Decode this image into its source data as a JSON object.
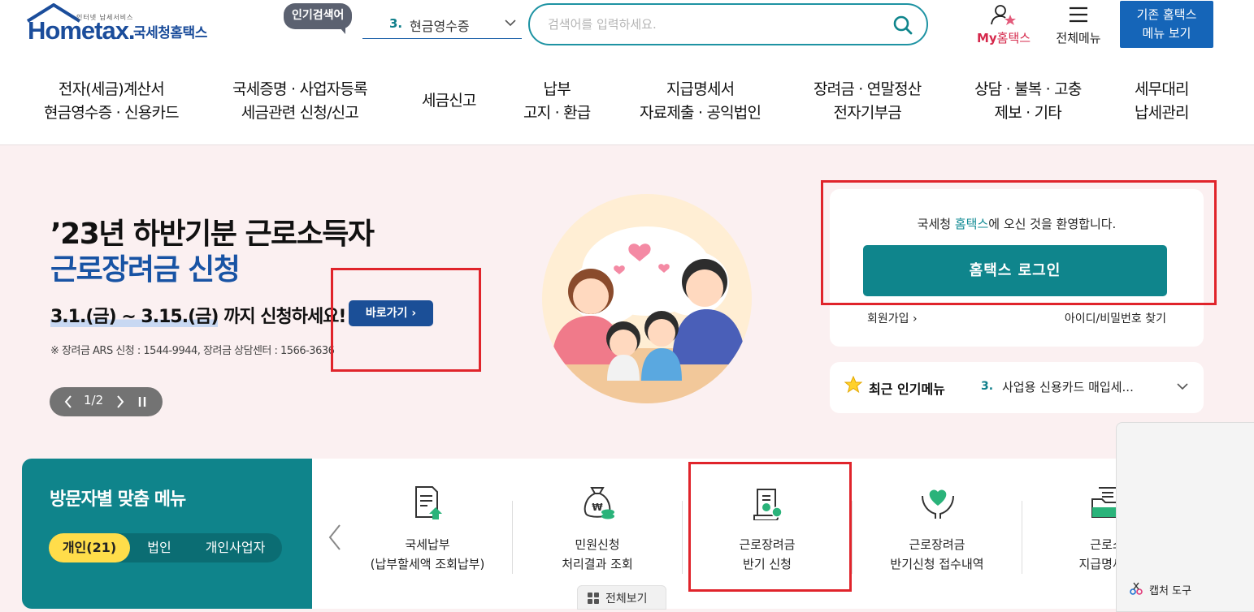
{
  "header": {
    "logo": {
      "small_text": "인터넷 납세서비스",
      "main_text": "Hometax.",
      "korean_name": "국세청홈택스"
    },
    "popular_tag": "인기검색어",
    "popular_select": {
      "rank": "3.",
      "value": "현금영수증"
    },
    "search": {
      "placeholder": "검색어를 입력하세요.",
      "value": ""
    },
    "my_hometax": {
      "my": "My",
      "label": "홈택스"
    },
    "all_menu": "전체메뉴",
    "old_menu_button": {
      "line1": "기존 홈택스",
      "line2": "메뉴 보기"
    }
  },
  "gnb": [
    {
      "line1": "전자(세금)계산서",
      "line2": "현금영수증 · 신용카드"
    },
    {
      "line1": "국세증명 · 사업자등록",
      "line2": "세금관련 신청/신고"
    },
    {
      "line1": "세금신고",
      "line2": ""
    },
    {
      "line1": "납부",
      "line2": "고지 · 환급"
    },
    {
      "line1": "지급명세서",
      "line2": "자료제출 · 공익법인"
    },
    {
      "line1": "장려금 · 연말정산",
      "line2": "전자기부금"
    },
    {
      "line1": "상담 · 불복 · 고충",
      "line2": "제보 · 기타"
    },
    {
      "line1": "세무대리",
      "line2": "납세관리"
    }
  ],
  "hero": {
    "title_line1": "’23년 하반기분 근로소득자",
    "title_line2": "근로장려금 신청",
    "period_text": "3.1.(금) ~ 3.15.(금)",
    "period_suffix": " 까지 신청하세요!",
    "goto_button": "바로가기",
    "note": "※ 장려금 ARS 신청 : 1544-9944, 장려금 상담센터 : 1566-3636",
    "slide_counter": "1/2"
  },
  "login_card": {
    "welcome_pre": "국세청 ",
    "welcome_highlight": "홈택스",
    "welcome_post": "에 오신 것을 환영합니다.",
    "login_button": "홈택스 로그인",
    "join_link": "회원가입",
    "find_link": "아이디/비밀번호 찾기"
  },
  "recent_menu": {
    "title": "최근 인기메뉴",
    "rank": "3.",
    "value": "사업용 신용카드 매입세..."
  },
  "visitor_menu": {
    "title": "방문자별 맞춤 메뉴",
    "tabs": [
      {
        "label": "개인(21)",
        "active": true
      },
      {
        "label": "법인",
        "active": false
      },
      {
        "label": "개인사업자",
        "active": false
      }
    ]
  },
  "menu_cards": [
    {
      "line1": "국세납부",
      "line2": "(납부할세액 조회납부)",
      "icon": "document-upload-icon"
    },
    {
      "line1": "민원신청",
      "line2": "처리결과 조회",
      "icon": "money-bag-icon"
    },
    {
      "line1": "근로장려금",
      "line2": "반기 신청",
      "icon": "certificate-icon"
    },
    {
      "line1": "근로장려금",
      "line2": "반기신청 접수내역",
      "icon": "hand-heart-icon"
    },
    {
      "line1": "근로소",
      "line2": "지급명세서",
      "icon": "folder-document-icon"
    }
  ],
  "view_all_button": "전체보기",
  "capture_tool": "캡처 도구",
  "colors": {
    "brand_blue": "#1b4d9b",
    "teal": "#0f858c",
    "hero_bg": "#fbf0f1",
    "highlight_red": "#e0242b",
    "tab_active": "#ffdd4a"
  }
}
